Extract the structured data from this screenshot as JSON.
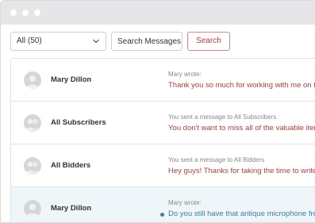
{
  "toolbar": {
    "filter_value": "All (50)",
    "search_placeholder": "Search Messages",
    "search_button_label": "Search"
  },
  "messages": [
    {
      "name": "Mary Dillon",
      "meta": "Mary wrote:",
      "preview": "Thank you so much for working with me on this",
      "unread": false
    },
    {
      "name": "All Subscribers",
      "meta": "You sent a message to All Subscribers",
      "preview": "You don't want to miss all of the valuable items",
      "unread": false
    },
    {
      "name": "All Bidders",
      "meta": "You sent a message to All Bidders",
      "preview": "Hey guys! Thanks for taking the time to write",
      "unread": false
    },
    {
      "name": "Mary Dillon",
      "meta": "Mary wrote:",
      "preview": "Do you still have that antique microphone fro",
      "unread": true
    }
  ],
  "colors": {
    "accent": "#a8413a",
    "unread_accent": "#3d7ea6",
    "selected_row_bg": "#eef6fa",
    "titlebar_bg": "#e6e6e8"
  }
}
